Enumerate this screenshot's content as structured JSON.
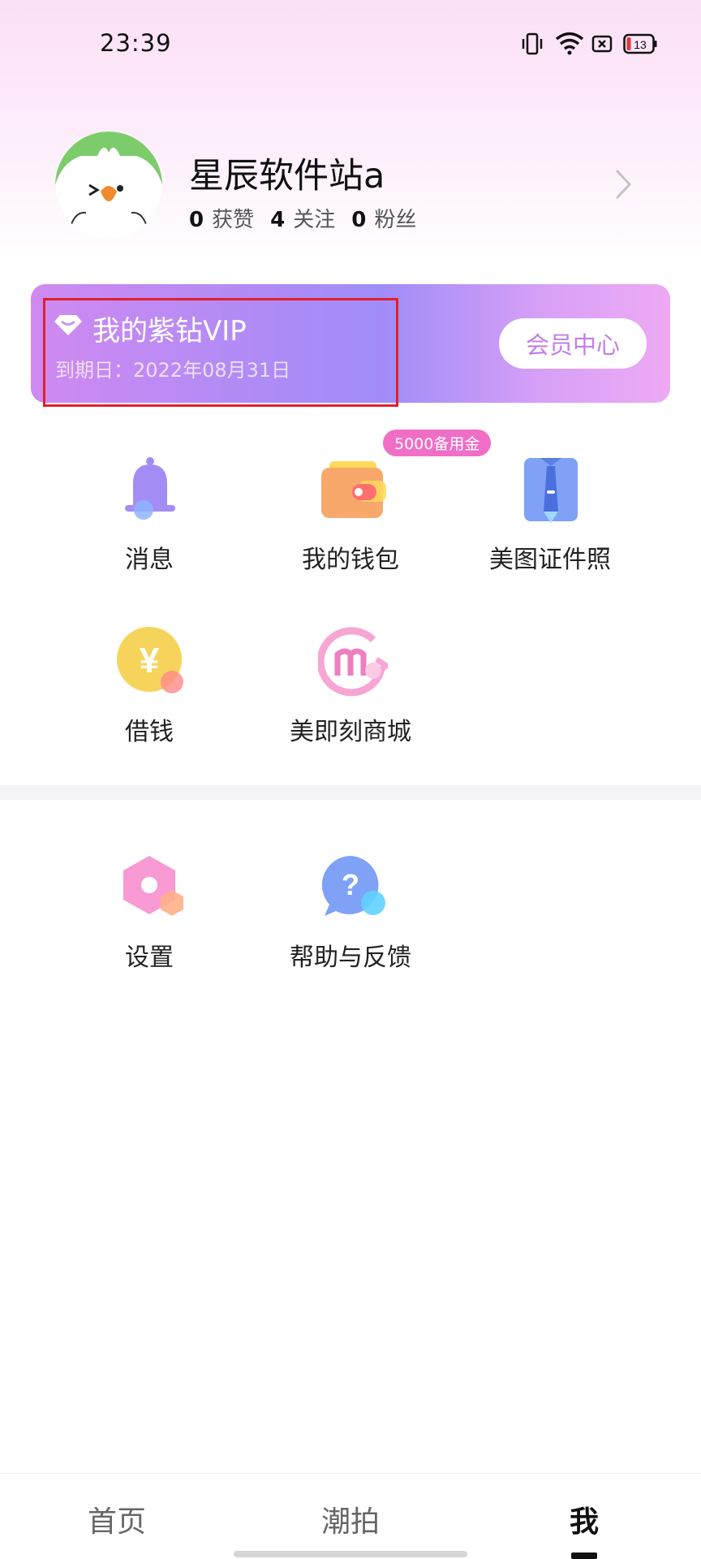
{
  "status_bar": {
    "time": "23:39",
    "battery": "13",
    "icons": [
      "vibrate-icon",
      "wifi-icon",
      "sim-blocked-icon",
      "battery-icon"
    ]
  },
  "profile": {
    "username": "星辰软件站a",
    "stats": [
      {
        "num": "0",
        "label": "获赞"
      },
      {
        "num": "4",
        "label": "关注"
      },
      {
        "num": "0",
        "label": "粉丝"
      }
    ]
  },
  "vip": {
    "title": "我的紫钻VIP",
    "expire": "到期日：2022年08月31日",
    "center_button": "会员中心"
  },
  "services": [
    {
      "label": "消息",
      "icon": "bell-icon"
    },
    {
      "label": "我的钱包",
      "icon": "wallet-icon",
      "badge": "5000备用金"
    },
    {
      "label": "美图证件照",
      "icon": "id-photo-icon"
    },
    {
      "label": "借钱",
      "icon": "yuan-coin-icon"
    },
    {
      "label": "美即刻商城",
      "icon": "mall-icon"
    }
  ],
  "tools": [
    {
      "label": "设置",
      "icon": "settings-hexagon-icon"
    },
    {
      "label": "帮助与反馈",
      "icon": "help-bubble-icon"
    }
  ],
  "bottom_nav": [
    {
      "label": "首页"
    },
    {
      "label": "潮拍"
    },
    {
      "label": "我",
      "active": true
    }
  ],
  "colors": {
    "accent_purple": "#a08cf8",
    "badge_pink": "#f06ec6",
    "highlight_red": "#e0202b"
  }
}
